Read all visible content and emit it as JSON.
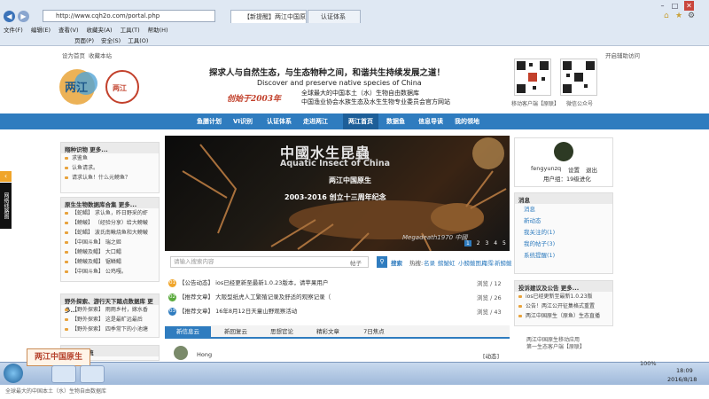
{
  "browser": {
    "url": "http://www.cqh2o.com/portal.php",
    "tabs": [
      "【新提醒】两江中国原生-...",
      "认证体系"
    ],
    "menu": [
      "文件(F)",
      "编辑(E)",
      "查看(V)",
      "收藏夹(A)",
      "工具(T)",
      "帮助(H)"
    ],
    "commands": [
      "页面(P)",
      "安全(S)",
      "工具(O)"
    ],
    "zoom": "100%"
  },
  "page": {
    "top_links": [
      "设为首页",
      "收藏本站"
    ],
    "top_right_link": "开启辅助访问",
    "slogan": "探求人与自然生态，与生态物种之间，和谐共生持续发展之道！",
    "slogan_en": "Discover and preserve native species of China",
    "since": "创始于2003年",
    "desc1": "全球最大的中国本土（水）生物自由数据库",
    "desc2": "中国渔业协会水族生态及水生生物专业委员会官方网站",
    "qr_labels": [
      "移动客户端【原联】",
      "微信公众号"
    ],
    "nav": [
      "鱼膳计划",
      "VI识别",
      "认证体系",
      "走进两江",
      "两江首页",
      "数据鱼",
      "信息导读",
      "我的领地"
    ],
    "left_panels": [
      {
        "title": "翔种识物 更多...",
        "items": [
          "求鉴鱼",
          "认鱼请求。",
          "请求认鱼！什么元鳑鱼？"
        ]
      },
      {
        "title": "原生生物数据库合集 更多...",
        "items": [
          "【蛇鲳】 求认鱼，昨日野采的虾",
          "【鳑鲏】 （经验分享）给大鳑鲏",
          "【蛇鲳】 波氏南鳅烧鱼和大鳑鲏",
          "【中国斗鱼】 瑞之姬",
          "【鳑鲏及鳎】 大口鳎",
          "【鳑鲏及鳎】 锯鳞鳎",
          "【中国斗鱼】 公鸡嘎。"
        ]
      },
      {
        "title": "野外探索、游行天下踏点数据库 更多...",
        "items": [
          "【野外探索】 雨雨乡村，嫁水香",
          "【野外探索】 这是最旷远最后",
          "【野外探索】 四季常下的小池塘"
        ]
      },
      {
        "title": "综合信息流",
        "items": []
      }
    ],
    "banner": {
      "title_cn": "中國水生昆蟲",
      "title_en": "Aquatic Insect of China",
      "sub": "两江中国原生",
      "anniv": "2003-2016 创立十三周年纪念",
      "credit": "Megadeath1970 中國",
      "pages": [
        "1",
        "2",
        "3",
        "4",
        "5"
      ]
    },
    "search": {
      "placeholder": "请输入搜索内容",
      "scope": "帖子",
      "button": "搜索",
      "hot_label": "热搜:",
      "hot": [
        "名录",
        "鳑鲏虹",
        "小鳑鲏图片",
        "雨霈",
        "新鳑鲏"
      ]
    },
    "news": [
      {
        "num": "01",
        "text": "【公告动态】 ios已经更新至最新1.0.23版本，请苹果用户",
        "stat": "浏览 / 12"
      },
      {
        "num": "02",
        "text": "【推荐文章】 大阪型纸虎人工繁殖记录及舒适的观察记录（",
        "stat": "浏览 / 26"
      },
      {
        "num": "03",
        "text": "【推荐文章】 16年8月12日天童山野观察活动",
        "stat": "浏览 / 43"
      }
    ],
    "subtabs": [
      "新信息云",
      "新回复云",
      "思想官论",
      "精彩文章",
      "7日焦点"
    ],
    "post_author": "Hong",
    "post_tag": "[动态]",
    "user": {
      "name": "fengyunzq",
      "settings": "设置",
      "logout": "退出",
      "group": "用户组：19级进化"
    },
    "messages": {
      "title": "消息",
      "items": [
        "消息",
        "新动态",
        "我关注的(1)",
        "我的帖子(3)",
        "系统提醒(1)"
      ]
    },
    "suggest": {
      "title": "投诉建议及公告 更多...",
      "items": [
        "ios已经更新至最新1.0.23版",
        "公告！两江公开征集格式重置",
        "两江中国原生（原鱼）生态直播"
      ]
    },
    "app_caption": "两江中国原生移动应用",
    "app_caption2": "第一生态客户端【原联】",
    "side_flag": "网络线路图",
    "footer": "全球最大的中国本土（水）生物自由数据库"
  },
  "taskbar": {
    "time": "18:09",
    "date": "2016/8/18"
  },
  "colors": {
    "nav": "#2f7cbf",
    "nav_highlight": "#1d5e98",
    "since": "#c2402b",
    "chrome": "#dfe8f3"
  }
}
